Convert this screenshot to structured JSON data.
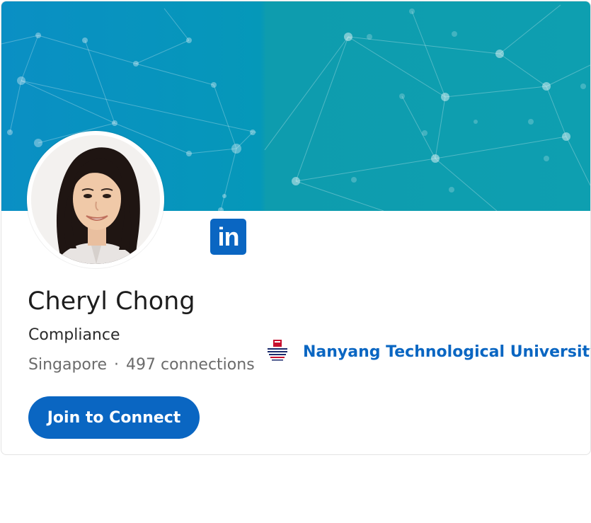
{
  "profile": {
    "name": "Cheryl Chong",
    "headline": "Compliance",
    "location": "Singapore",
    "separator": "·",
    "connections": "497 connections",
    "join_button_label": "Join to Connect",
    "avatar_alt": "Cheryl Chong"
  },
  "brand": {
    "logo_text": "in",
    "logo_icon": "linkedin-icon",
    "accent_color": "#0a66c2"
  },
  "education": {
    "school_name": "Nanyang Technological University",
    "logo_icon": "ntu-logo",
    "logo_lines": [
      "NANYANG",
      "TECHNOLOGICAL",
      "UNIVERSITY",
      "SINGAPORE"
    ]
  }
}
